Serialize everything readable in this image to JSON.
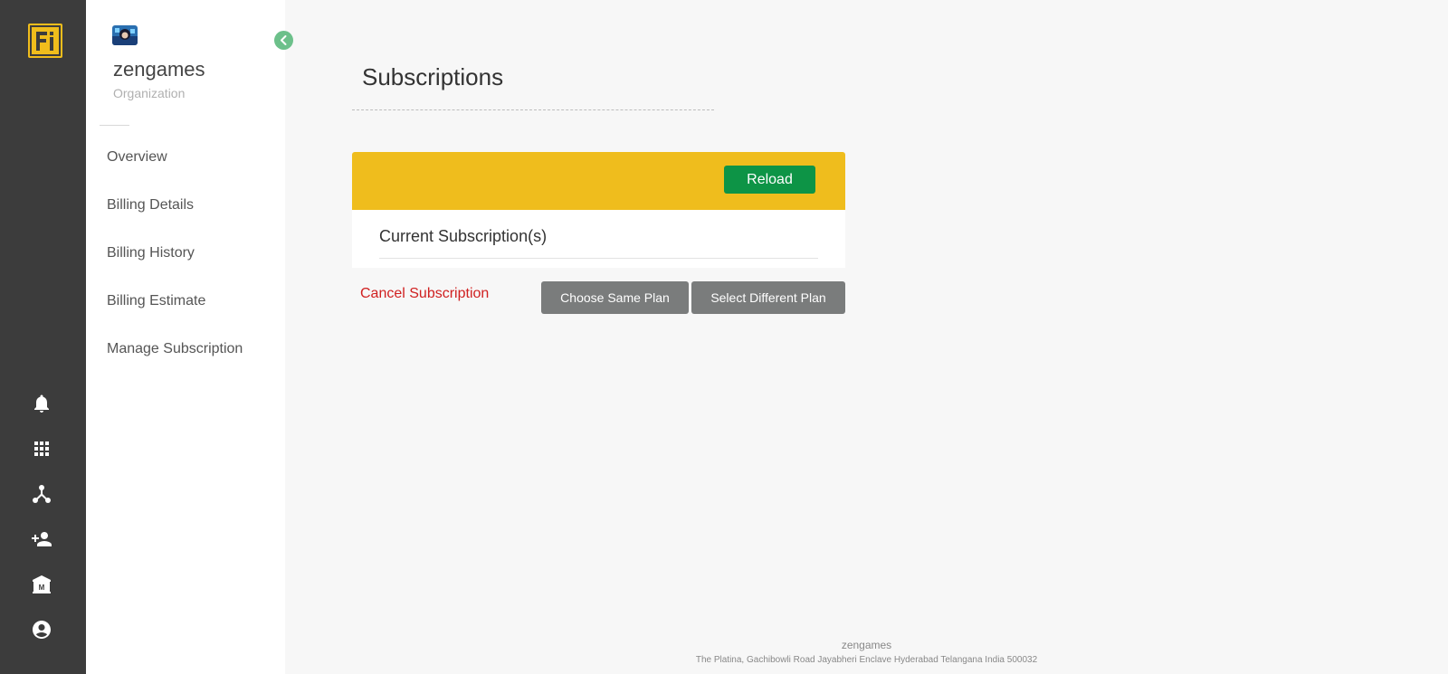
{
  "brand": {
    "logo_text": "Fi",
    "logo_color": "#f0bd1c"
  },
  "rail": {
    "icons": [
      "bell-icon",
      "apps-grid-icon",
      "hub-network-icon",
      "person-add-icon",
      "bank-icon",
      "account-circle-icon"
    ]
  },
  "sidebar": {
    "org_name": "zengames",
    "org_type": "Organization",
    "items": [
      {
        "label": "Overview"
      },
      {
        "label": "Billing Details"
      },
      {
        "label": "Billing History"
      },
      {
        "label": "Billing Estimate"
      },
      {
        "label": "Manage Subscription"
      }
    ]
  },
  "main": {
    "title": "Subscriptions",
    "reload_label": "Reload",
    "current_subscriptions_label": "Current Subscription(s)",
    "cancel_label": "Cancel Subscription",
    "choose_same_label": "Choose Same Plan",
    "select_different_label": "Select Different Plan"
  },
  "footer": {
    "name": "zengames",
    "address": "The Platina, Gachibowli Road Jayabheri Enclave Hyderabad Telangana India 500032"
  },
  "colors": {
    "rail_bg": "#3c3c3c",
    "accent_yellow": "#efbd1d",
    "reload_green": "#0d9446",
    "cancel_red": "#d02020",
    "secondary_button": "#7a7c7c",
    "collapse_green": "#6cc08a"
  }
}
